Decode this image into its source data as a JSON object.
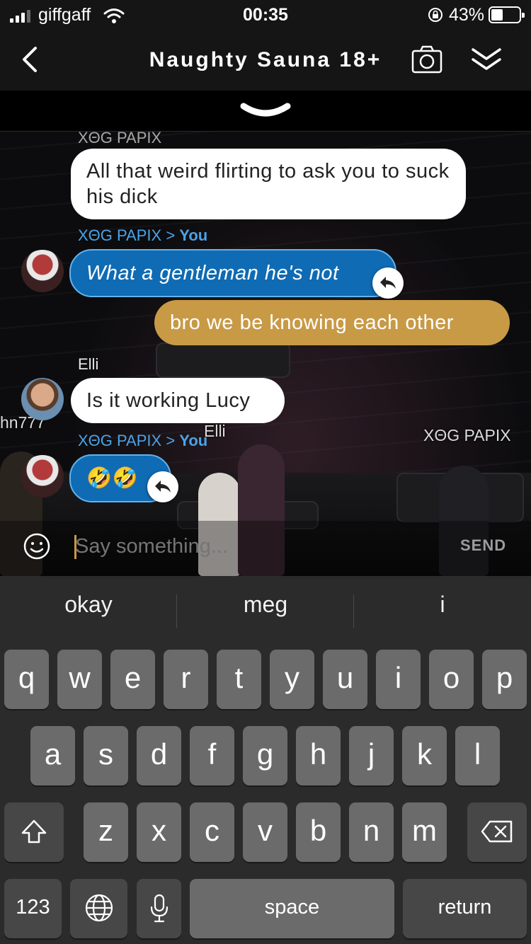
{
  "status_bar": {
    "carrier": "giffgaff",
    "time": "00:35",
    "battery": "43%",
    "battery_level": 0.43
  },
  "header": {
    "title": "Naughty Sauna 18+"
  },
  "chat": {
    "messages": [
      {
        "sender": "XΘG PAPIX",
        "text": "All that weird flirting to ask you to suck his dick"
      },
      {
        "sender": "XΘG PAPIX",
        "recipient": "You",
        "text": "What a gentleman he's not"
      },
      {
        "text": "bro we be knowing each other"
      },
      {
        "sender": "Elli",
        "text": "Is it working Lucy"
      },
      {
        "sender": "XΘG PAPIX",
        "recipient": "You",
        "text": "🤣🤣"
      }
    ],
    "arrow": ">",
    "avatar_name_labels": [
      "hn777",
      "Elli",
      "XΘG PAPIX"
    ]
  },
  "input": {
    "placeholder": "Say something...",
    "send_label": "SEND"
  },
  "keyboard": {
    "suggestions": [
      "okay",
      "meg",
      "i"
    ],
    "row1": [
      "q",
      "w",
      "e",
      "r",
      "t",
      "y",
      "u",
      "i",
      "o",
      "p"
    ],
    "row2": [
      "a",
      "s",
      "d",
      "f",
      "g",
      "h",
      "j",
      "k",
      "l"
    ],
    "row3": [
      "z",
      "x",
      "c",
      "v",
      "b",
      "n",
      "m"
    ],
    "numbers_label": "123",
    "space_label": "space",
    "return_label": "return"
  },
  "colors": {
    "accent_gold": "#c89a46",
    "bubble_blue": "#0f6bb3",
    "sender_blue": "#4aa3e8"
  },
  "icons": [
    "back-chevron-icon",
    "camera-icon",
    "collapse-icon",
    "expand-chevron-icon",
    "reply-icon",
    "emoji-icon",
    "shift-icon",
    "backspace-icon",
    "globe-icon",
    "microphone-icon"
  ]
}
